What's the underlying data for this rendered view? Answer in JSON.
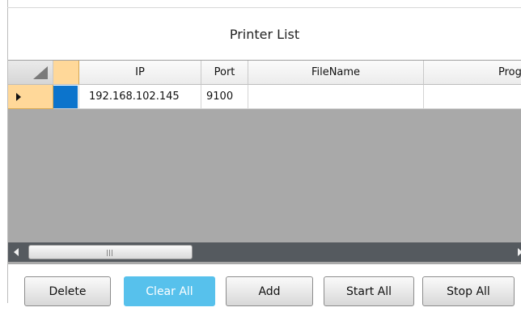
{
  "panel": {
    "title": "Printer List"
  },
  "grid": {
    "columns": [
      "IP",
      "Port",
      "FileName",
      "Prog"
    ],
    "rows": [
      {
        "ip": "192.168.102.145",
        "port": "9100",
        "filename": "",
        "progress": ""
      }
    ],
    "colors": {
      "selected_row_header": "#ffd899",
      "selection_cell": "#0c74cc",
      "empty_area": "#a9a9a9",
      "scrollbar": "#555a5f"
    }
  },
  "buttons": {
    "delete": "Delete",
    "clear_all": "Clear All",
    "add": "Add",
    "start_all": "Start All",
    "stop_all": "Stop All"
  },
  "colors": {
    "primary_button": "#57c1ec"
  }
}
